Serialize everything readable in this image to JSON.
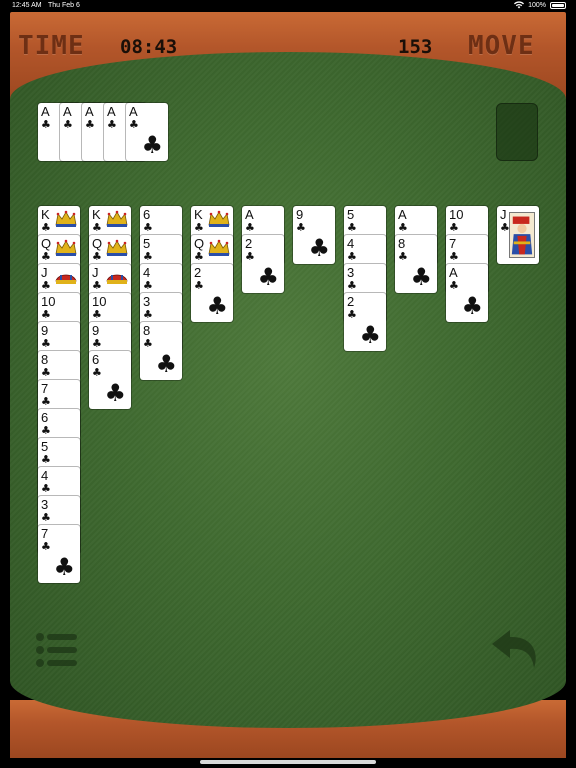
{
  "status_bar": {
    "time": "12:45 AM",
    "date": "Thu Feb 6",
    "battery": "100%"
  },
  "hud": {
    "time_label": "TIME",
    "time_value": "08:43",
    "move_value": "153",
    "move_label": "MOVE"
  },
  "colors": {
    "felt": "#3f6a30",
    "wood": "#b3562a",
    "hud_label": "#6e2f14"
  },
  "foundation": [
    {
      "rank": "A",
      "suit": "♣"
    },
    {
      "rank": "A",
      "suit": "♣"
    },
    {
      "rank": "A",
      "suit": "♣"
    },
    {
      "rank": "A",
      "suit": "♣"
    },
    {
      "rank": "A",
      "suit": "♣"
    }
  ],
  "tableau": [
    {
      "cards": [
        {
          "rank": "K",
          "suit": "♣",
          "face": "king"
        },
        {
          "rank": "Q",
          "suit": "♣",
          "face": "queen"
        },
        {
          "rank": "J",
          "suit": "♣",
          "face": "jack"
        },
        {
          "rank": "10",
          "suit": "♣"
        },
        {
          "rank": "9",
          "suit": "♣"
        },
        {
          "rank": "8",
          "suit": "♣"
        },
        {
          "rank": "7",
          "suit": "♣"
        },
        {
          "rank": "6",
          "suit": "♣"
        },
        {
          "rank": "5",
          "suit": "♣"
        },
        {
          "rank": "4",
          "suit": "♣"
        },
        {
          "rank": "3",
          "suit": "♣"
        },
        {
          "rank": "7",
          "suit": "♣"
        }
      ]
    },
    {
      "cards": [
        {
          "rank": "K",
          "suit": "♣",
          "face": "king"
        },
        {
          "rank": "Q",
          "suit": "♣",
          "face": "queen"
        },
        {
          "rank": "J",
          "suit": "♣",
          "face": "jack"
        },
        {
          "rank": "10",
          "suit": "♣"
        },
        {
          "rank": "9",
          "suit": "♣"
        },
        {
          "rank": "6",
          "suit": "♣"
        }
      ]
    },
    {
      "cards": [
        {
          "rank": "6",
          "suit": "♣"
        },
        {
          "rank": "5",
          "suit": "♣"
        },
        {
          "rank": "4",
          "suit": "♣"
        },
        {
          "rank": "3",
          "suit": "♣"
        },
        {
          "rank": "8",
          "suit": "♣"
        }
      ]
    },
    {
      "cards": [
        {
          "rank": "K",
          "suit": "♣",
          "face": "king"
        },
        {
          "rank": "Q",
          "suit": "♣",
          "face": "queen"
        },
        {
          "rank": "2",
          "suit": "♣"
        }
      ]
    },
    {
      "cards": [
        {
          "rank": "A",
          "suit": "♣"
        },
        {
          "rank": "2",
          "suit": "♣"
        }
      ]
    },
    {
      "cards": [
        {
          "rank": "9",
          "suit": "♣"
        }
      ]
    },
    {
      "cards": [
        {
          "rank": "5",
          "suit": "♣"
        },
        {
          "rank": "4",
          "suit": "♣"
        },
        {
          "rank": "3",
          "suit": "♣"
        },
        {
          "rank": "2",
          "suit": "♣"
        }
      ]
    },
    {
      "cards": [
        {
          "rank": "A",
          "suit": "♣"
        },
        {
          "rank": "8",
          "suit": "♣"
        }
      ]
    },
    {
      "cards": [
        {
          "rank": "10",
          "suit": "♣"
        },
        {
          "rank": "7",
          "suit": "♣"
        },
        {
          "rank": "A",
          "suit": "♣"
        }
      ]
    },
    {
      "cards": [
        {
          "rank": "J",
          "suit": "♣",
          "face": "jack-portrait"
        }
      ]
    }
  ],
  "icons": {
    "menu": "menu-list-icon",
    "undo": "undo-arrow-icon"
  }
}
